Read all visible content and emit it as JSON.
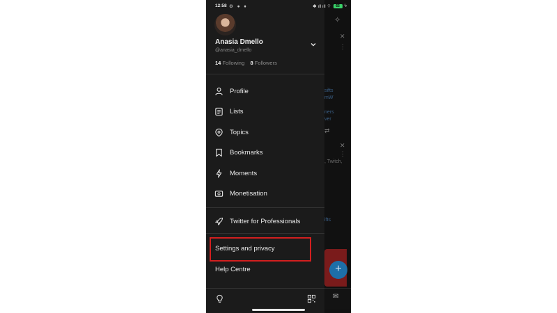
{
  "status_bar": {
    "time": "12:58",
    "left_icons": "⚙ ● ♦",
    "right_icons": "✱ ıll ıll ⌔",
    "battery": "65"
  },
  "profile": {
    "name": "Anasia Dmello",
    "handle": "@anasia_dmello",
    "following_count": "14",
    "following_label": "Following",
    "followers_count": "8",
    "followers_label": "Followers"
  },
  "menu": [
    {
      "label": "Profile",
      "icon": "person-icon"
    },
    {
      "label": "Lists",
      "icon": "list-icon"
    },
    {
      "label": "Topics",
      "icon": "topic-icon"
    },
    {
      "label": "Bookmarks",
      "icon": "bookmark-icon"
    },
    {
      "label": "Moments",
      "icon": "lightning-icon"
    },
    {
      "label": "Monetisation",
      "icon": "money-icon"
    }
  ],
  "professional": {
    "label": "Twitter for Professionals",
    "icon": "rocket-icon"
  },
  "settings": {
    "settings_label": "Settings and privacy",
    "help_label": "Help Centre"
  },
  "background_fragments": [
    "sifts",
    "mW",
    "ners",
    "ver",
    ", Twitch,",
    "ifts"
  ],
  "fab_symbol": "+",
  "colors": {
    "drawer_bg": "#1b1b1b",
    "highlight": "#d31f1f",
    "fab": "#1d6fa8",
    "battery": "#3bd36a"
  }
}
